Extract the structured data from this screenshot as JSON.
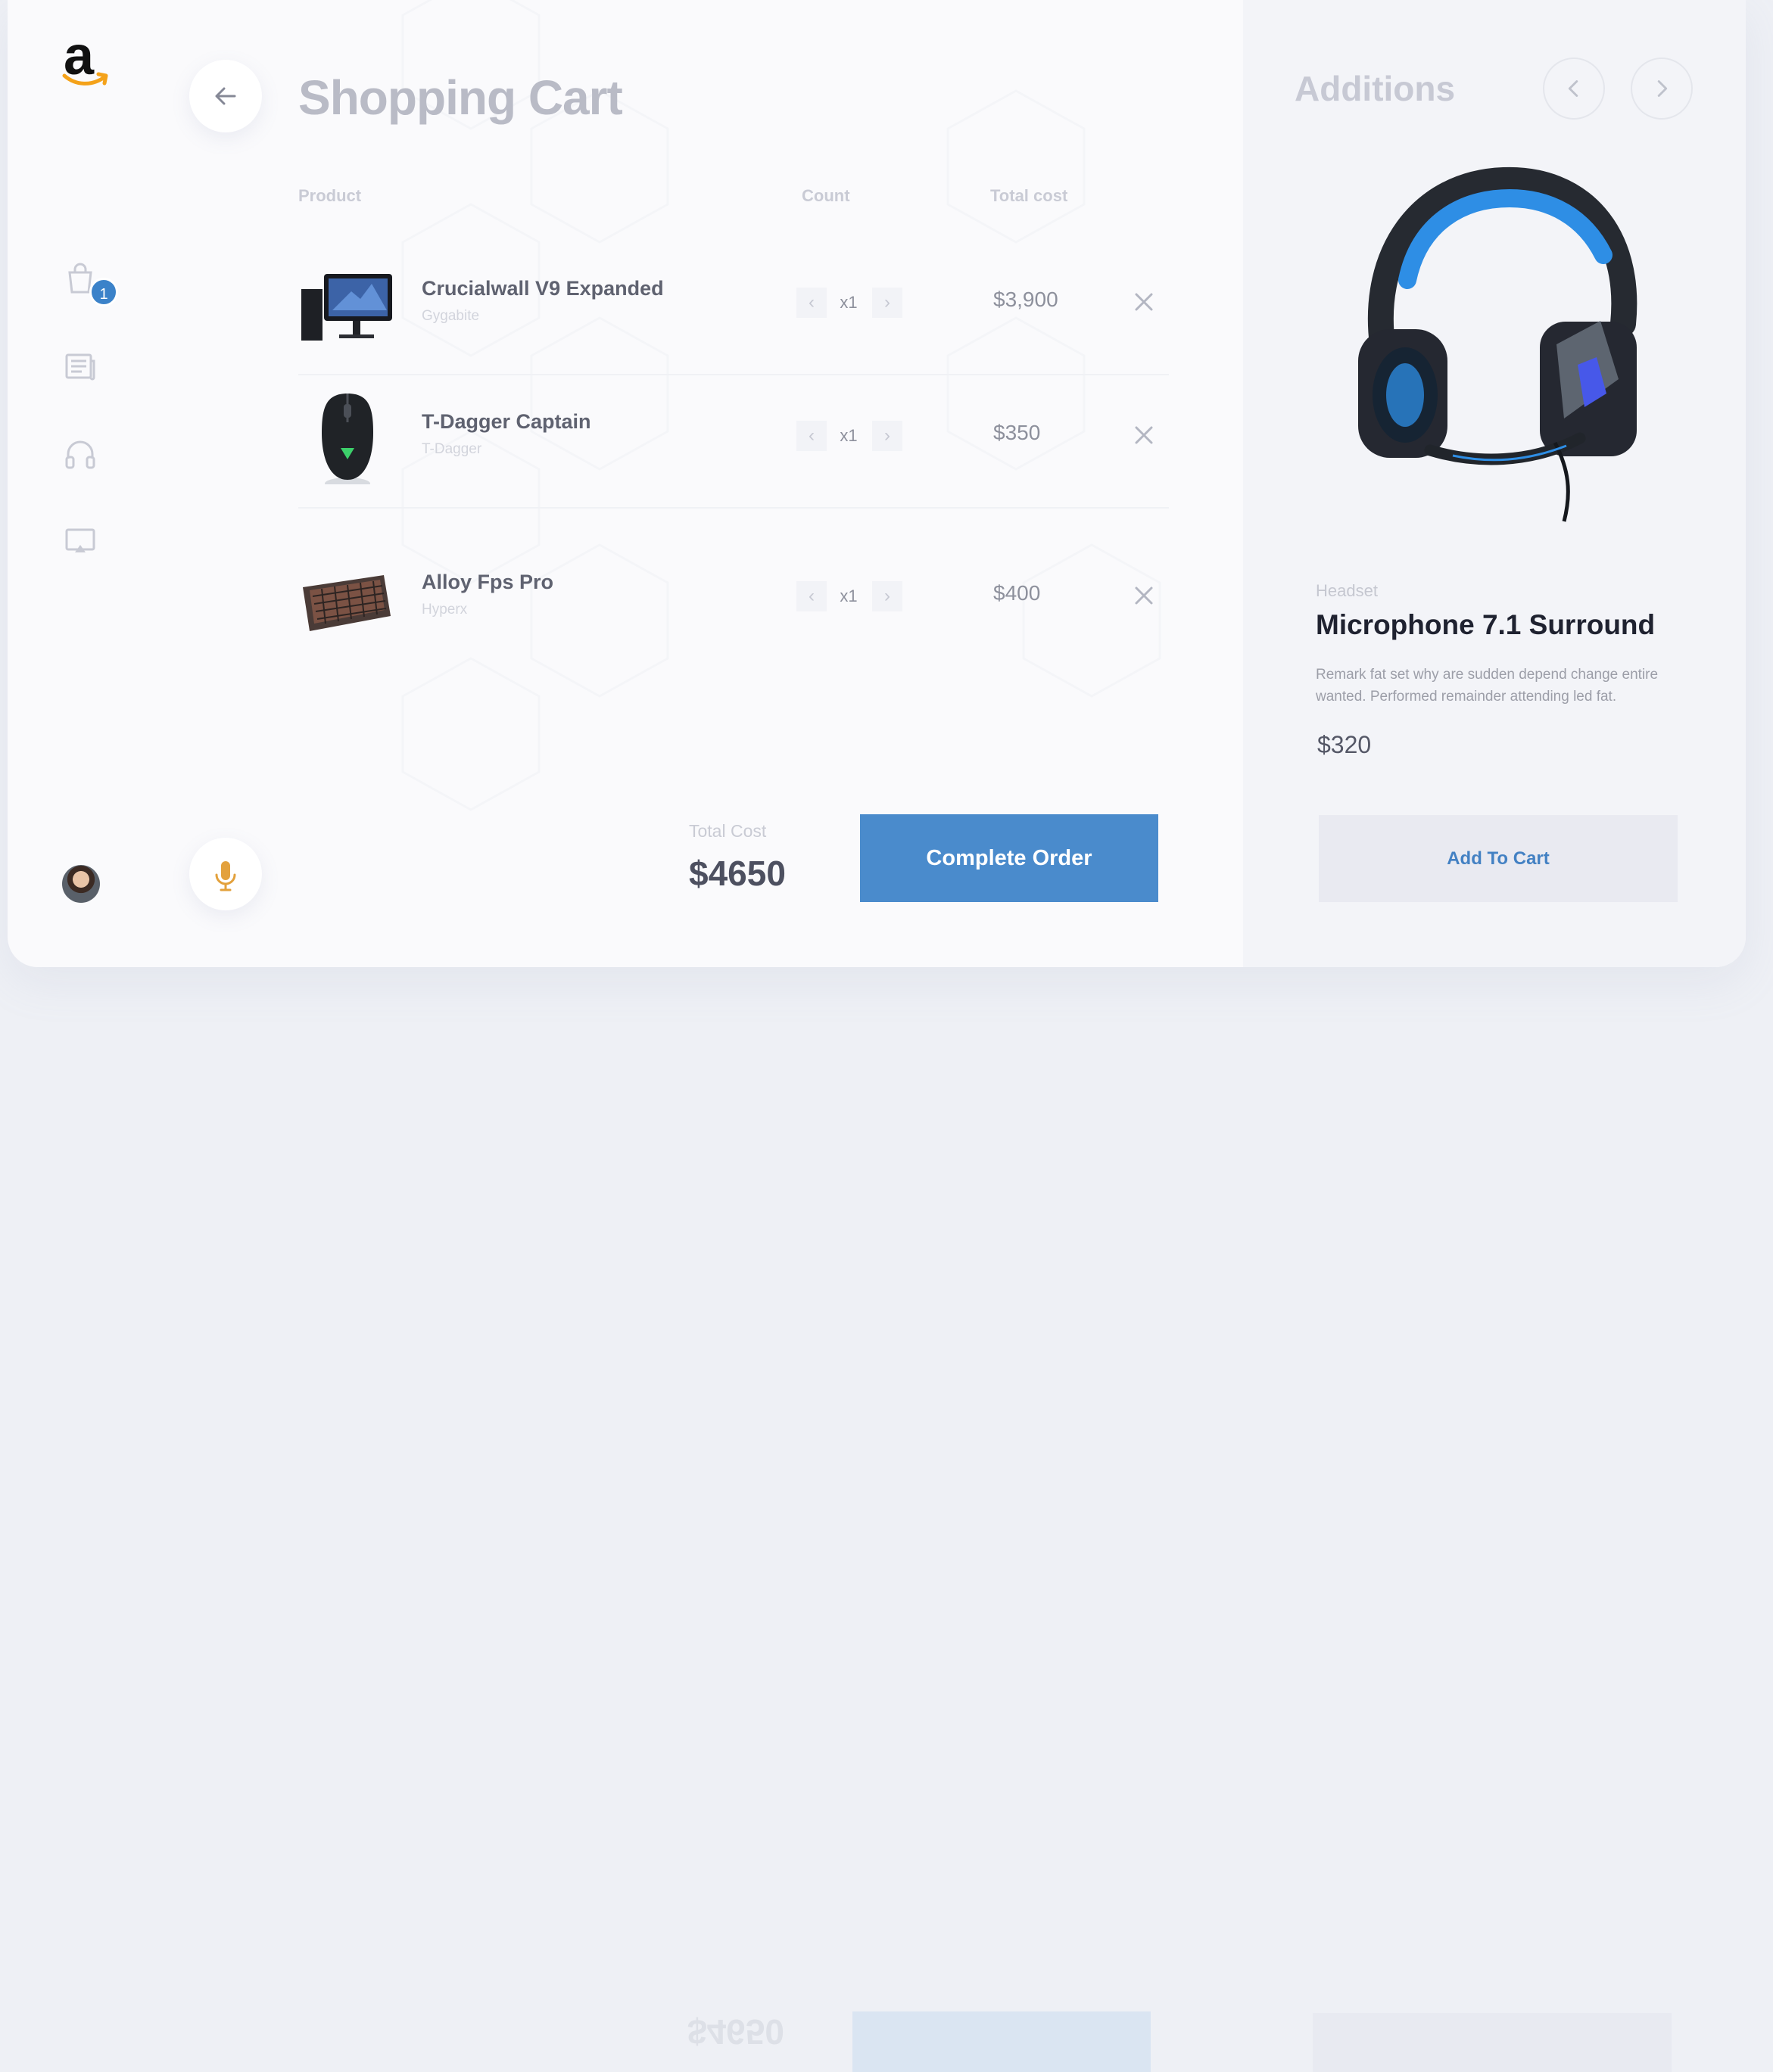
{
  "sidebar": {
    "logo_letter": "a",
    "cart_badge": "1",
    "icons": [
      "cart-icon",
      "news-icon",
      "headphones-icon",
      "monitor-icon"
    ]
  },
  "main": {
    "title": "Shopping Cart",
    "columns": {
      "product": "Product",
      "count": "Count",
      "total_cost": "Total cost"
    },
    "items": [
      {
        "name": "Crucialwall V9 Expanded",
        "brand": "Gygabite",
        "count": "x1",
        "price": "$3,900"
      },
      {
        "name": "T-Dagger Captain",
        "brand": "T-Dagger",
        "count": "x1",
        "price": "$350"
      },
      {
        "name": "Alloy Fps Pro",
        "brand": "Hyperx",
        "count": "x1",
        "price": "$400"
      }
    ],
    "total_label": "Total Cost",
    "total_value": "$4650",
    "complete_button": "Complete Order"
  },
  "additions": {
    "title": "Additions",
    "category": "Headset",
    "product_title": "Microphone 7.1 Surround",
    "description": "Remark fat set why are sudden depend change entire wanted. Performed remainder attending led fat.",
    "price": "$320",
    "add_button": "Add To Cart"
  },
  "colors": {
    "accent": "#4a8bcc",
    "badge": "#3b82c9",
    "title": "#b9bbc6",
    "bg": "#fafafc"
  }
}
